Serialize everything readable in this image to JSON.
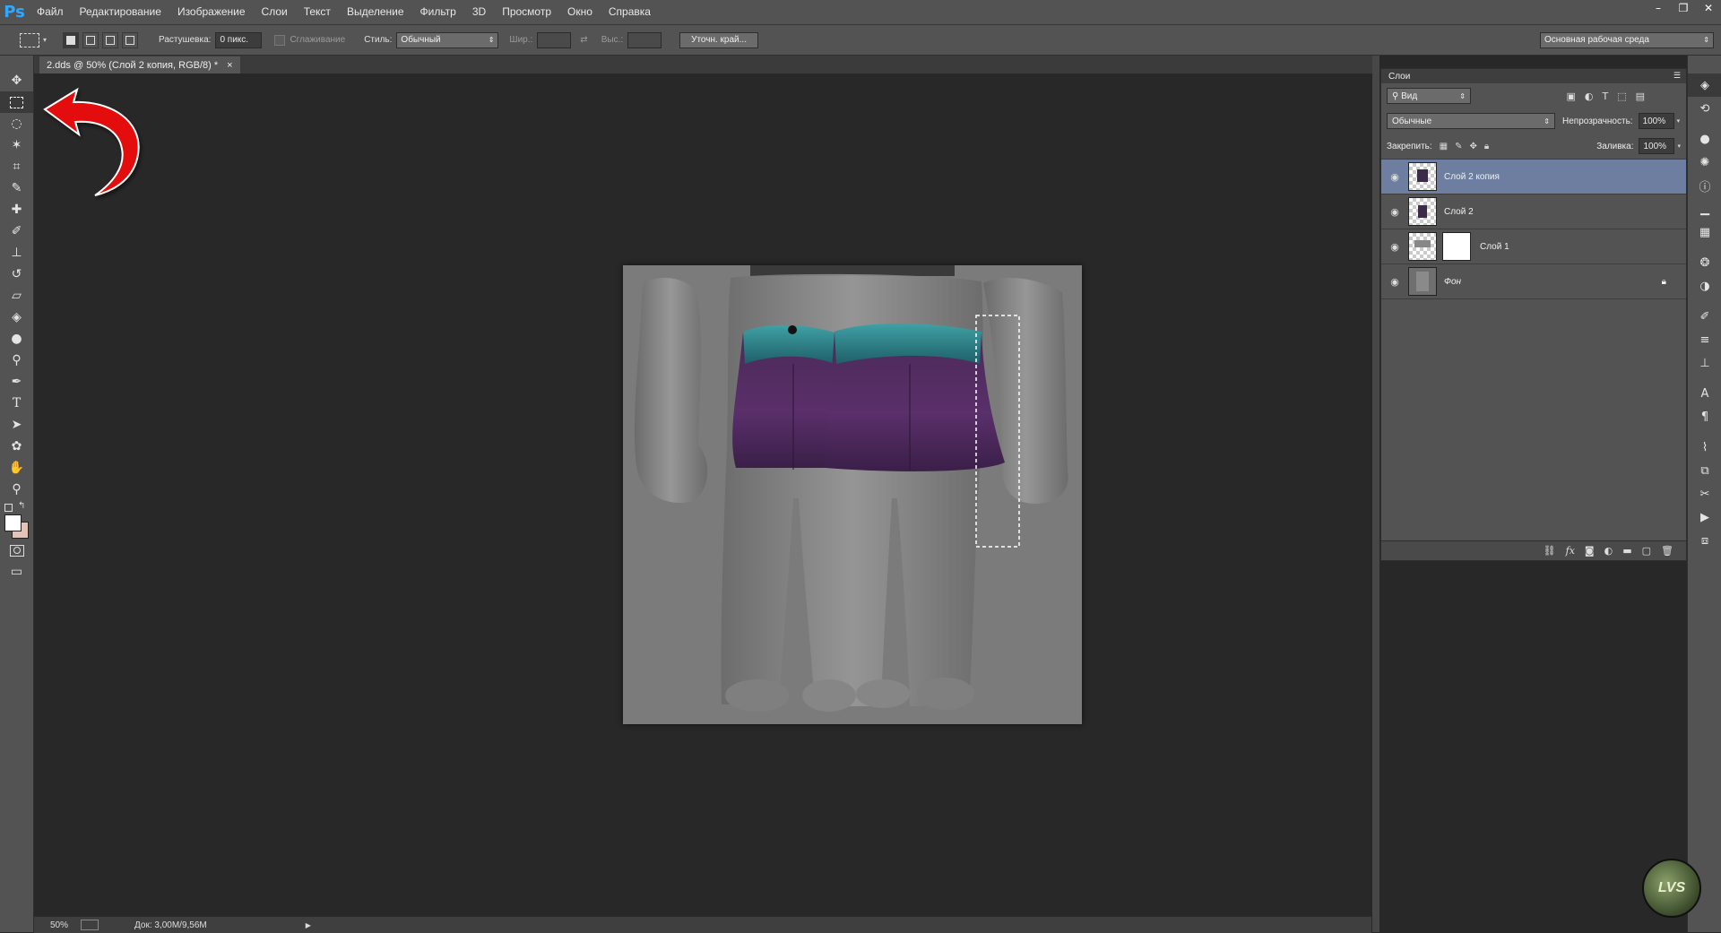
{
  "app": {
    "logo": "Ps"
  },
  "menu": [
    "Файл",
    "Редактирование",
    "Изображение",
    "Слои",
    "Текст",
    "Выделение",
    "Фильтр",
    "3D",
    "Просмотр",
    "Окно",
    "Справка"
  ],
  "window_controls": {
    "minimize": "–",
    "restore": "❐",
    "close": "✕"
  },
  "options": {
    "feather_label": "Растушевка:",
    "feather_value": "0 пикс.",
    "antialias_label": "Сглаживание",
    "style_label": "Стиль:",
    "style_value": "Обычный",
    "width_label": "Шир.:",
    "height_label": "Выс.:",
    "refine_edge": "Уточн. край...",
    "workspace": "Основная рабочая среда"
  },
  "document": {
    "tab_title": "2.dds @ 50% (Слой 2 копия, RGB/8) *",
    "tab_close": "×"
  },
  "status": {
    "zoom": "50%",
    "doc_info": "Док: 3,00M/9,56M"
  },
  "layers_panel": {
    "title": "Слои",
    "filter_label": "Вид",
    "blend_mode": "Обычные",
    "opacity_label": "Непрозрачность:",
    "opacity_value": "100%",
    "lock_label": "Закрепить:",
    "fill_label": "Заливка:",
    "fill_value": "100%",
    "layers": [
      {
        "name": "Слой 2 копия",
        "selected": true
      },
      {
        "name": "Слой 2",
        "selected": false
      },
      {
        "name": "Слой 1",
        "selected": false,
        "has_mask": true
      },
      {
        "name": "Фон",
        "selected": false,
        "locked": true
      }
    ]
  },
  "watermark": "LVS"
}
